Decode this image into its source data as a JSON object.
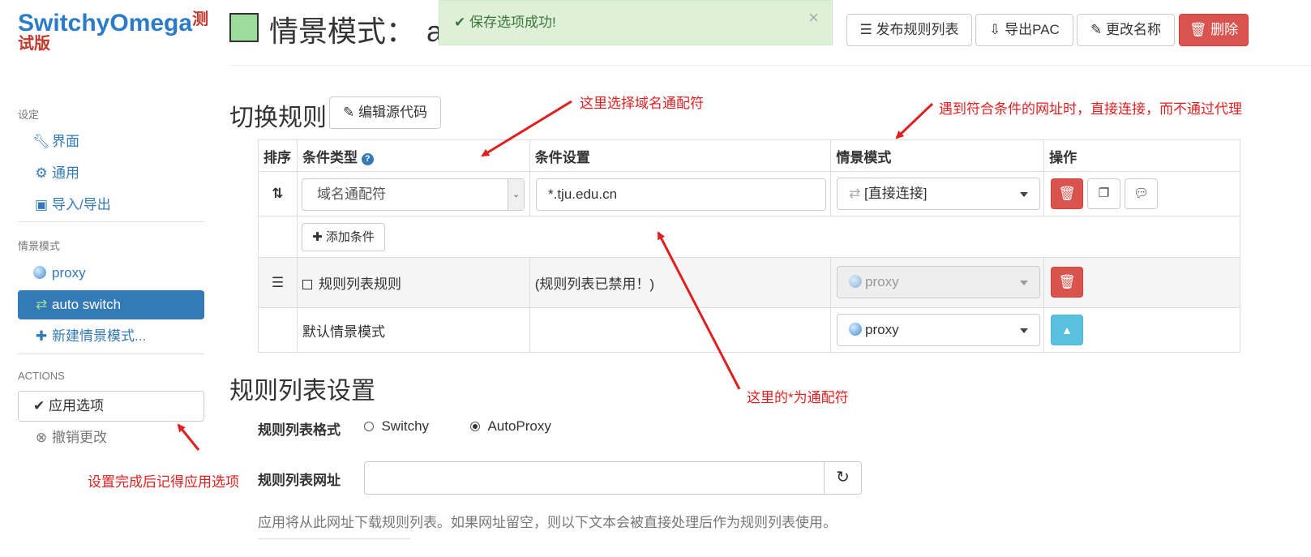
{
  "brand": {
    "name": "SwitchyOmega",
    "badge_1": "测",
    "badge_2": "试版"
  },
  "sidebar": {
    "settings_header": "设定",
    "settings_items": [
      {
        "label": "界面",
        "icon": "wrench-icon"
      },
      {
        "label": "通用",
        "icon": "gear-icon"
      },
      {
        "label": "导入/导出",
        "icon": "floppy-icon"
      }
    ],
    "profiles_header": "情景模式",
    "profiles": [
      {
        "label": "proxy",
        "icon": "globe-icon",
        "active": false
      },
      {
        "label": "auto switch",
        "icon": "retweet-icon",
        "active": true
      },
      {
        "label": "新建情景模式...",
        "icon": "plus-icon",
        "active": false
      }
    ],
    "actions_header": "ACTIONS",
    "apply_label": "应用选项",
    "discard_label": "撤销更改"
  },
  "header": {
    "title": "情景模式：",
    "title_tail": "a",
    "alert_text": "保存选项成功!",
    "buttons": {
      "publish": "发布规则列表",
      "export": "导出PAC",
      "rename": "更改名称",
      "delete": "删除"
    },
    "swatch_color": "#9ddc9d"
  },
  "switch_rules": {
    "title": "切换规则",
    "edit_source": "编辑源代码",
    "columns": [
      "排序",
      "条件类型",
      "条件设置",
      "情景模式",
      "操作"
    ],
    "rule": {
      "condition_type": "域名通配符",
      "condition_value": "*.tju.edu.cn",
      "profile": "[直接连接]"
    },
    "add_condition": "添加条件",
    "rulelist_rule": {
      "label": "规则列表规则",
      "setting": "(规则列表已禁用！)",
      "profile": "proxy"
    },
    "default_rule": {
      "label": "默认情景模式",
      "profile": "proxy"
    }
  },
  "rulelist_settings": {
    "title": "规则列表设置",
    "format_label": "规则列表格式",
    "format_options": [
      "Switchy",
      "AutoProxy"
    ],
    "format_selected": "AutoProxy",
    "url_label": "规则列表网址",
    "url_value": "",
    "help_text": "应用将从此网址下载规则列表。如果网址留空，则以下文本会被直接处理后作为规则列表使用。"
  },
  "annotations": {
    "domain_wildcard": "这里选择域名通配符",
    "direct_connect": "遇到符合条件的网址时，直接连接，而不通过代理",
    "star_wildcard": "这里的*为通配符",
    "apply_reminder": "设置完成后记得应用选项"
  },
  "colors": {
    "primary": "#337ab7",
    "danger": "#d9534f",
    "info": "#5bc0de",
    "success_bg": "#dff0d8",
    "annotation": "#e02020"
  }
}
